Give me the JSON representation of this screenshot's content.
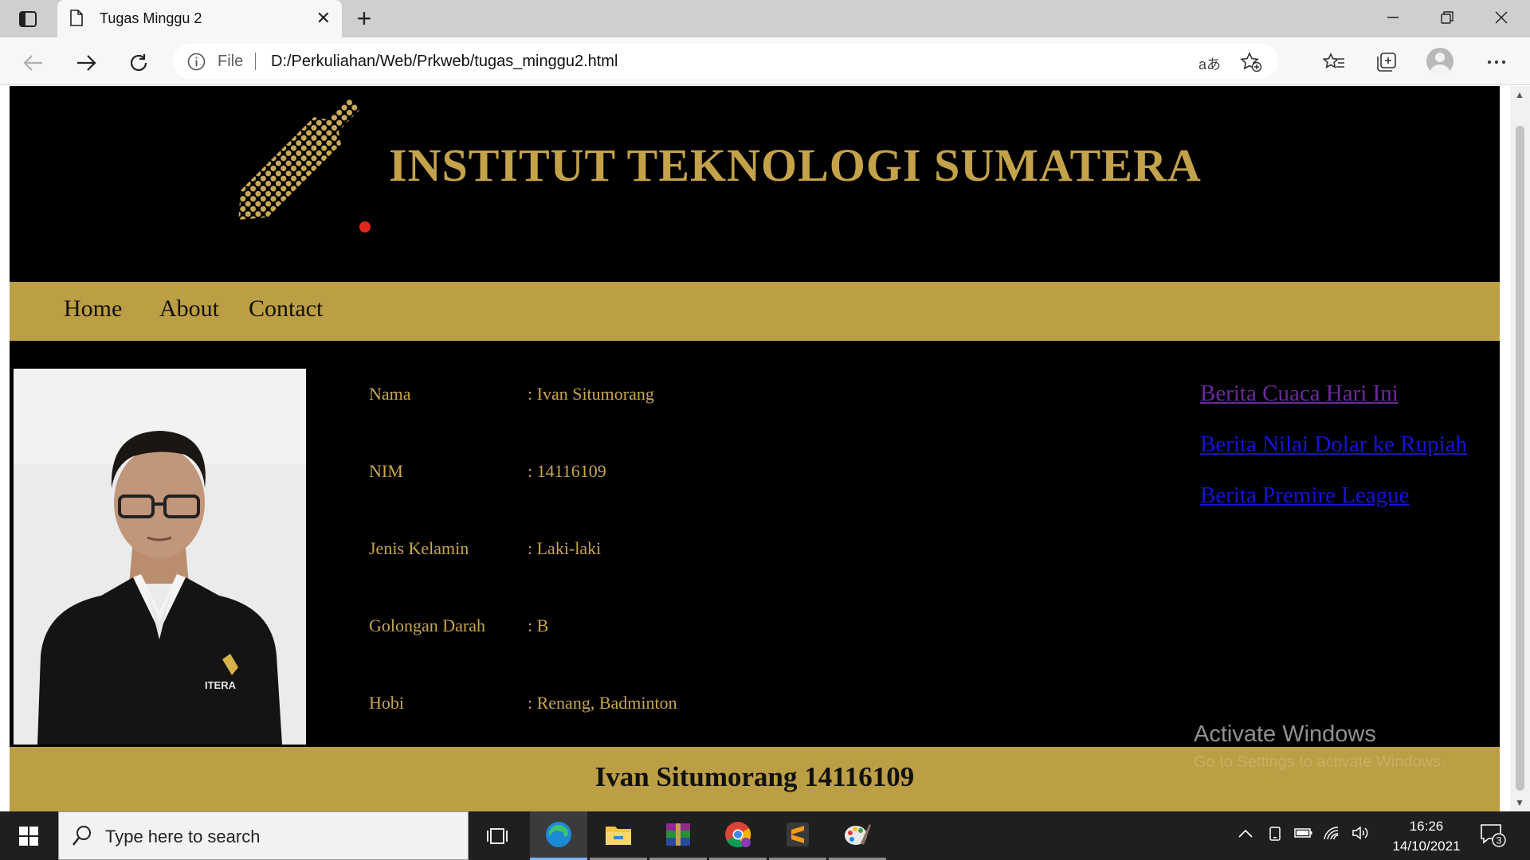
{
  "browser": {
    "tab_title": "Tugas Minggu 2",
    "file_label": "File",
    "url": "D:/Perkuliahan/Web/Prkweb/tugas_minggu2.html",
    "read_aloud_glyph": "aあ"
  },
  "page": {
    "site_title": "INSTITUT TEKNOLOGI SUMATERA",
    "nav": [
      {
        "label": "Home"
      },
      {
        "label": "About"
      },
      {
        "label": "Contact"
      }
    ],
    "photo_badge": "ITERA",
    "profile": [
      {
        "label": "Nama",
        "value": ": Ivan Situmorang"
      },
      {
        "label": "NIM",
        "value": ": 14116109"
      },
      {
        "label": "Jenis Kelamin",
        "value": ": Laki-laki"
      },
      {
        "label": "Golongan Darah",
        "value": ": B"
      },
      {
        "label": "Hobi",
        "value": ": Renang, Badminton"
      }
    ],
    "news_links": [
      {
        "label": "Berita Cuaca Hari Ini",
        "color": "#6a2a9a",
        "visited": true
      },
      {
        "label": "Berita Nilai Dolar ke Rupiah",
        "color": "#1414d8",
        "visited": false
      },
      {
        "label": "Berita Premire League",
        "color": "#1414d8",
        "visited": false
      }
    ],
    "footer": "Ivan Situmorang 14116109",
    "colors": {
      "gold": "#bc9e44",
      "text_gold": "#c8a64a",
      "background": "#000000"
    }
  },
  "watermark": {
    "title": "Activate Windows",
    "subtitle": "Go to Settings to activate Windows."
  },
  "taskbar": {
    "search_placeholder": "Type here to search",
    "time": "16:26",
    "date": "14/10/2021",
    "notification_count": "3",
    "apps": [
      "task-view",
      "edge",
      "file-explorer",
      "winrar",
      "chrome",
      "sublime-text",
      "paint"
    ]
  }
}
